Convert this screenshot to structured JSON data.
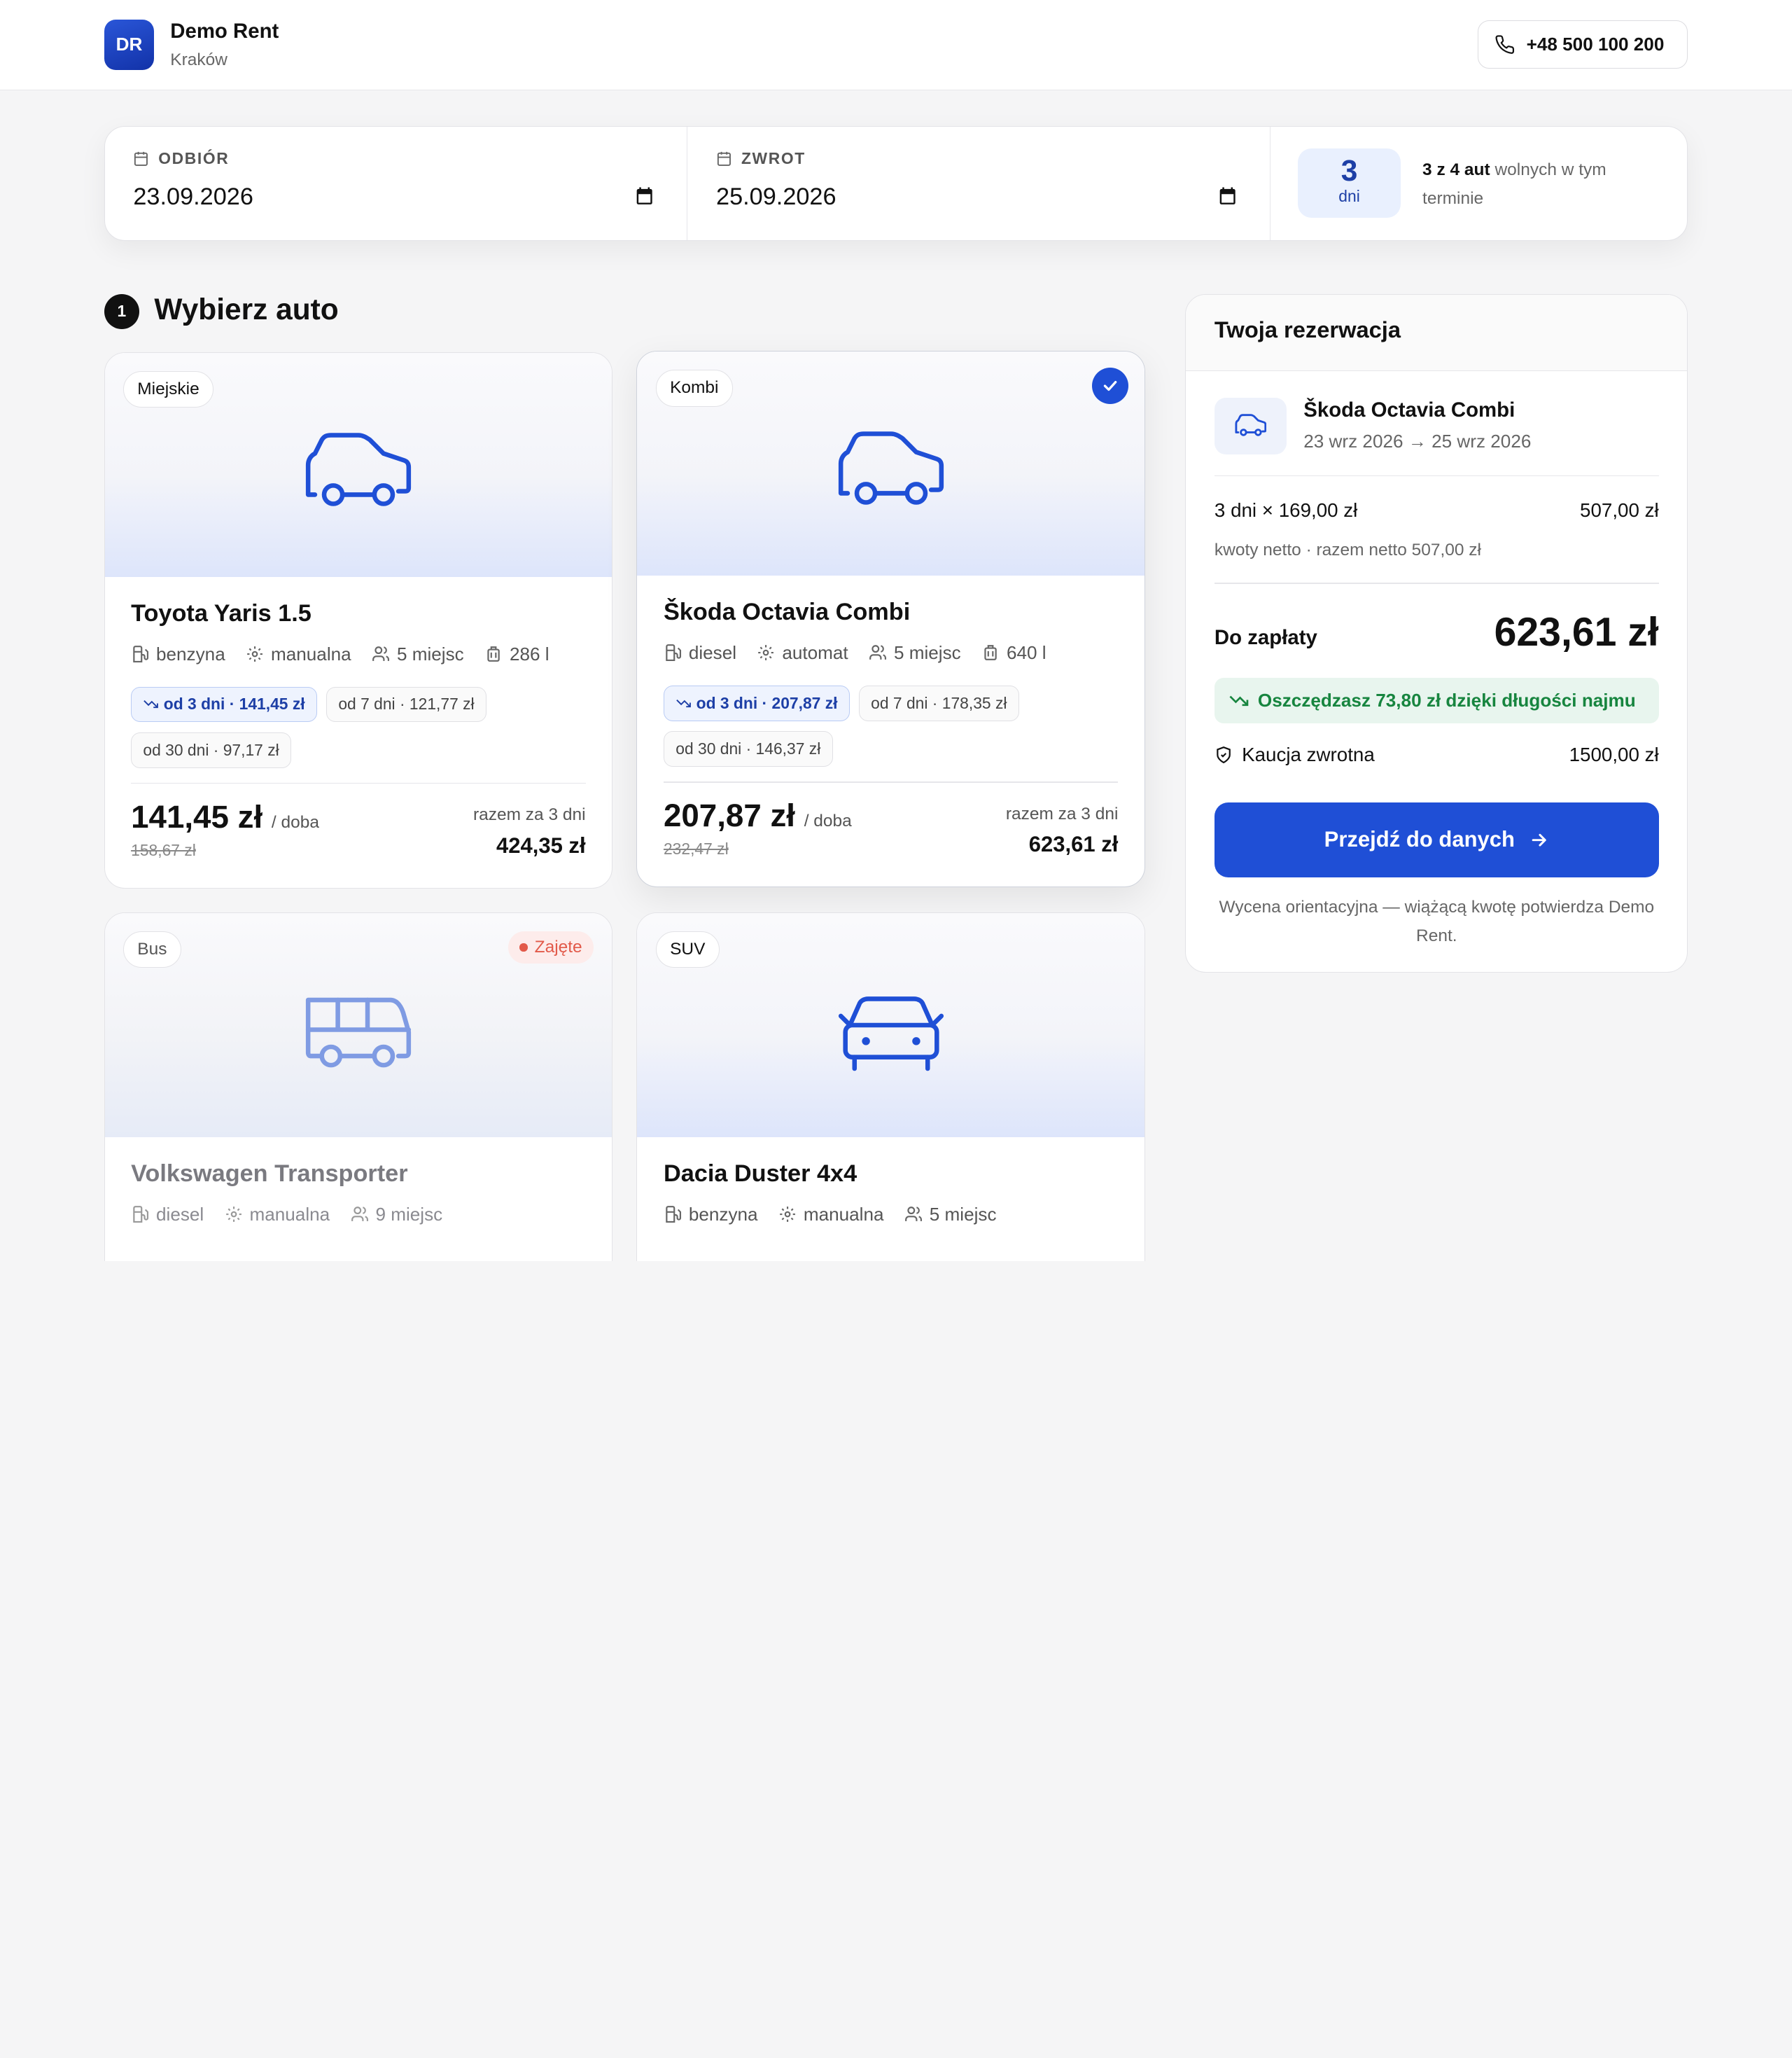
{
  "header": {
    "logo": "DR",
    "brand": "Demo Rent",
    "city": "Kraków",
    "phone": "+48 500 100 200"
  },
  "dates": {
    "pickup_label": "ODBIÓR",
    "pickup_value": "23.09.2026",
    "return_label": "ZWROT",
    "return_value": "25.09.2026",
    "days_num": "3",
    "days_label": "dni",
    "avail_bold": "3 z 4 aut",
    "avail_rest": " wolnych w tym terminie"
  },
  "section": {
    "step": "1",
    "title": "Wybierz auto"
  },
  "cars": [
    {
      "category": "Miejskie",
      "name": "Toyota Yaris 1.5",
      "fuel": "benzyna",
      "gearbox": "manualna",
      "seats": "5 miejsc",
      "trunk": "286 l",
      "tiers": [
        "od 3 dni · 141,45 zł",
        "od 7 dni · 121,77 zł",
        "od 30 dni · 97,17 zł"
      ],
      "price": "141,45 zł",
      "unit": "/ doba",
      "old_price": "158,67 zł",
      "total_label": "razem za 3 dni",
      "total": "424,35 zł"
    },
    {
      "category": "Kombi",
      "name": "Škoda Octavia Combi",
      "fuel": "diesel",
      "gearbox": "automat",
      "seats": "5 miejsc",
      "trunk": "640 l",
      "tiers": [
        "od 3 dni · 207,87 zł",
        "od 7 dni · 178,35 zł",
        "od 30 dni · 146,37 zł"
      ],
      "price": "207,87 zł",
      "unit": "/ doba",
      "old_price": "232,47 zł",
      "total_label": "razem za 3 dni",
      "total": "623,61 zł"
    },
    {
      "category": "Bus",
      "status": "Zajęte",
      "name": "Volkswagen Transporter",
      "fuel": "diesel",
      "gearbox": "manualna",
      "seats": "9 miejsc"
    },
    {
      "category": "SUV",
      "name": "Dacia Duster 4x4",
      "fuel": "benzyna",
      "gearbox": "manualna",
      "seats": "5 miejsc"
    }
  ],
  "summary": {
    "title": "Twoja rezerwacja",
    "car": "Škoda Octavia Combi",
    "dates": "23 wrz 2026 → 25 wrz 2026",
    "line_label": "3 dni × 169,00 zł",
    "line_value": "507,00 zł",
    "note": "kwoty netto · razem netto 507,00 zł",
    "due_label": "Do zapłaty",
    "due_value": "623,61 zł",
    "savings": "Oszczędzasz 73,80 zł dzięki długości najmu",
    "deposit_label": "Kaucja zwrotna",
    "deposit_value": "1500,00 zł",
    "cta": "Przejdź do danych",
    "disclaimer": "Wycena orientacyjna — wiążącą kwotę potwierdza Demo Rent."
  },
  "colors": {
    "accent": "#1f4fd6",
    "success": "#17853f",
    "busy": "#e25a4a"
  }
}
